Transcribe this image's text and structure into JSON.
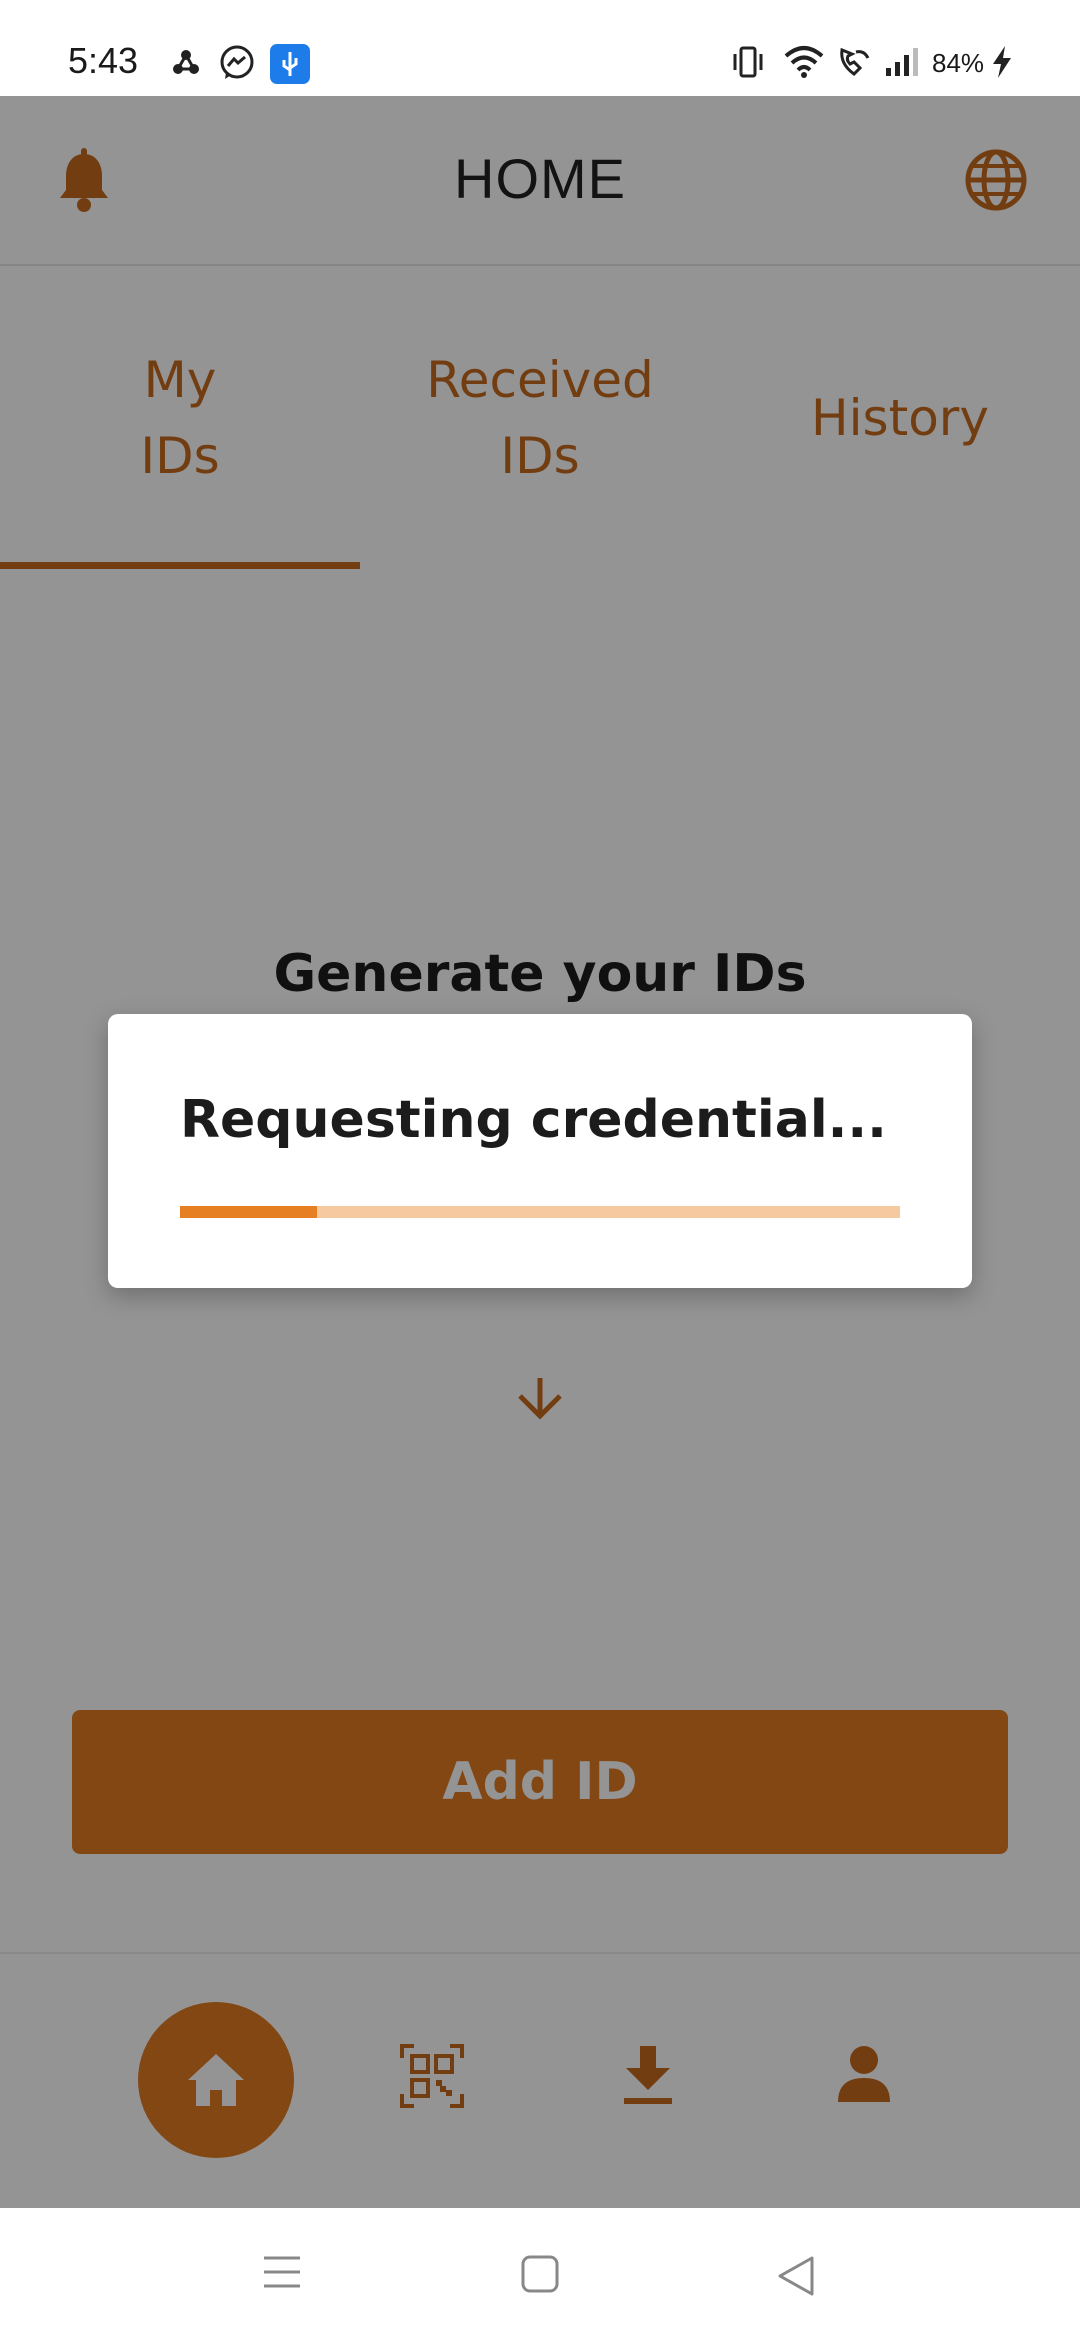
{
  "status_bar": {
    "time": "5:43",
    "battery": "84%"
  },
  "header": {
    "title": "HOME",
    "left_icon": "bell-icon",
    "right_icon": "globe-icon"
  },
  "tabs": [
    {
      "label_line1": "My",
      "label_line2": "IDs",
      "selected": true
    },
    {
      "label_line1": "Received",
      "label_line2": "IDs",
      "selected": false
    },
    {
      "label_line1": "History",
      "label_line2": "",
      "selected": false
    }
  ],
  "main": {
    "empty_title": "Generate your IDs",
    "add_button_label": "Add ID"
  },
  "dialog": {
    "message": "Requesting credential...",
    "progress": 0.19
  },
  "bottom_nav": [
    {
      "icon": "home-icon",
      "active": true
    },
    {
      "icon": "qr-scan-icon",
      "active": false
    },
    {
      "icon": "download-icon",
      "active": false
    },
    {
      "icon": "profile-icon",
      "active": false
    }
  ],
  "colors": {
    "accent": "#e27a24",
    "tab_text": "#c76a1f",
    "progress_fill": "#e67e22",
    "progress_track": "#f7c9a0"
  }
}
